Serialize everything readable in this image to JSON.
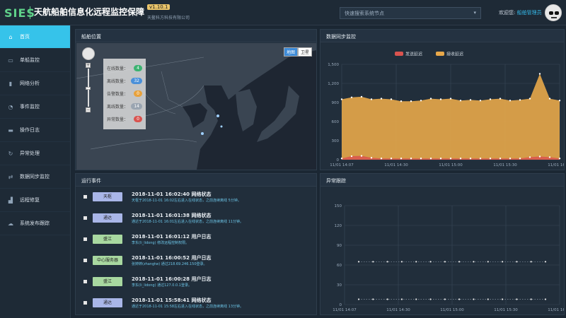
{
  "header": {
    "logo": "SIES",
    "title": "天航船舶信息化远程监控保障",
    "version": "v1.10.1",
    "company": "天鳌科方科技有限公司",
    "node_select": {
      "value": "快速搜索系统节点"
    },
    "welcome_prefix": "欢迎您: ",
    "username": "船舶管理员"
  },
  "sidebar": {
    "items": [
      {
        "label": "首页",
        "icon": "home-icon",
        "glyph": "⌂",
        "active": true
      },
      {
        "label": "单船监控",
        "icon": "monitor-icon",
        "glyph": "▭",
        "active": false
      },
      {
        "label": "网络分析",
        "icon": "bar-chart-icon",
        "glyph": "▮",
        "active": false
      },
      {
        "label": "事件监控",
        "icon": "gauge-icon",
        "glyph": "◔",
        "active": false
      },
      {
        "label": "操作日志",
        "icon": "laptop-icon",
        "glyph": "▬",
        "active": false
      },
      {
        "label": "异常处理",
        "icon": "refresh-icon",
        "glyph": "↻",
        "active": false
      },
      {
        "label": "数据同步监控",
        "icon": "exchange-icon",
        "glyph": "⇄",
        "active": false
      },
      {
        "label": "远程修复",
        "icon": "signal-icon",
        "glyph": "▟",
        "active": false
      },
      {
        "label": "系统发布跟踪",
        "icon": "cloud-icon",
        "glyph": "☁",
        "active": false
      }
    ]
  },
  "ship_map": {
    "title": "船舶位置",
    "map_type": {
      "options": [
        "地图",
        "卫星"
      ],
      "selected": "地图"
    },
    "legend": [
      {
        "label": "在线数量：",
        "count": "4",
        "color": "#3cb371"
      },
      {
        "label": "离线数量：",
        "count": "32",
        "color": "#4a90d9"
      },
      {
        "label": "告警数量：",
        "count": "0",
        "color": "#e8a23c"
      },
      {
        "label": "离线数量：",
        "count": "14",
        "color": "#9aa5b1"
      },
      {
        "label": "异常数量：",
        "count": "0",
        "color": "#d9534f"
      }
    ]
  },
  "sync_chart": {
    "title": "数据同步监控",
    "chart_data": {
      "type": "area",
      "legend": [
        "发送延迟",
        "接收延迟"
      ],
      "legend_colors": [
        "#d9534f",
        "#e8a84a"
      ],
      "ylim": [
        0,
        1500
      ],
      "yticks": [
        "0",
        "300",
        "600",
        "900",
        "1,200",
        "1,500"
      ],
      "xticks": [
        "11/01 14:07",
        "11/01 14:30",
        "11/01 15:00",
        "11/01 15:30",
        "11/01 16:00"
      ],
      "series": [
        {
          "name": "发送延迟",
          "values": [
            20,
            55,
            60,
            30,
            20,
            20,
            20,
            20,
            20,
            20,
            20,
            20,
            20,
            20,
            20,
            20,
            20,
            20,
            20,
            40,
            50,
            40,
            20
          ]
        },
        {
          "name": "接收延迟",
          "values": [
            950,
            980,
            990,
            950,
            960,
            950,
            920,
            920,
            930,
            960,
            950,
            960,
            930,
            940,
            930,
            950,
            960,
            930,
            940,
            960,
            1350,
            960,
            930
          ]
        }
      ]
    }
  },
  "events": {
    "title": "运行事件",
    "items": [
      {
        "tag": "天枢",
        "tag_color": "#a9b6e8",
        "title": "2018-11-01 16:02:40 网络状态",
        "desc": "天枢于2018-11-01 16:02左右进入在线状态，之前连续离线 5分钟。"
      },
      {
        "tag": "通达",
        "tag_color": "#a9b6e8",
        "title": "2018-11-01 16:01:38 网络状态",
        "desc": "通达于2018-11-01 16:01左右进入在线状态，之前连续离线 11分钟。"
      },
      {
        "tag": "盛江",
        "tag_color": "#a8d8a0",
        "title": "2018-11-01 16:01:12 用户日志",
        "desc": "李东(li_lidong) 修改远程控制权限。"
      },
      {
        "tag": "中心服务器",
        "tag_color": "#a8d8a0",
        "title": "2018-11-01 16:00:52 用户日志",
        "desc": "张婷婷(zhangtw) 通过218.69.246.150登录。"
      },
      {
        "tag": "盛江",
        "tag_color": "#a8d8a0",
        "title": "2018-11-01 16:00:28 用户日志",
        "desc": "李东(li_lidong) 通过127.0.0.1登录。"
      },
      {
        "tag": "通达",
        "tag_color": "#a9b6e8",
        "title": "2018-11-01 15:58:41 网络状态",
        "desc": "通达于2018-11-01 15:58左右进入在线状态，之前连续离线 13分钟。"
      }
    ]
  },
  "anomaly_chart": {
    "title": "异常跟踪",
    "chart_data": {
      "type": "line",
      "ylim": [
        0,
        150
      ],
      "yticks": [
        "0",
        "30",
        "60",
        "90",
        "120",
        "150"
      ],
      "xticks": [
        "11/01 14:07",
        "11/01 14:30",
        "11/01 15:00",
        "11/01 15:30",
        "11/01 16:00"
      ],
      "series": [
        {
          "values": [
            65,
            65,
            65,
            65,
            65,
            65,
            65,
            65,
            65,
            65,
            65,
            65,
            65,
            65
          ]
        },
        {
          "values": [
            8,
            8,
            8,
            8,
            8,
            8,
            8,
            8,
            8,
            8,
            8,
            8,
            8,
            8
          ]
        }
      ]
    }
  }
}
